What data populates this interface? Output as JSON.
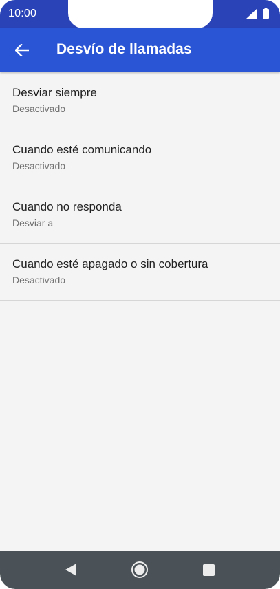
{
  "status_bar": {
    "time": "10:00",
    "icons": [
      "signal-icon",
      "battery-icon"
    ]
  },
  "header": {
    "title": "Desvío de llamadas",
    "back_icon": "arrow-left-icon"
  },
  "list": {
    "items": [
      {
        "title": "Desviar siempre",
        "subtitle": "Desactivado"
      },
      {
        "title": "Cuando esté comunicando",
        "subtitle": "Desactivado"
      },
      {
        "title": "Cuando no responda",
        "subtitle": "Desviar a"
      },
      {
        "title": "Cuando esté apagado o sin cobertura",
        "subtitle": "Desactivado"
      }
    ]
  },
  "nav_bar": {
    "icons": [
      "back-triangle-icon",
      "home-circle-icon",
      "recents-square-icon"
    ]
  },
  "colors": {
    "status_bar": "#2a44b8",
    "app_bar": "#2a55d4",
    "background": "#f4f4f4",
    "nav_bar": "#4a5257"
  }
}
